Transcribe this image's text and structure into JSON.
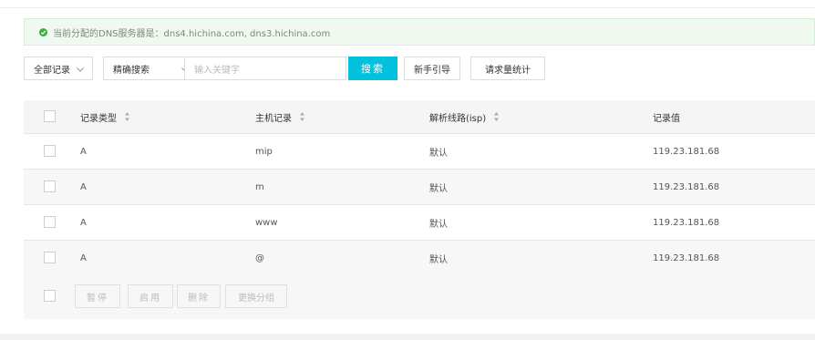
{
  "notice": {
    "text": "当前分配的DNS服务器是：dns4.hichina.com, dns3.hichina.com",
    "icon": "check-circle-icon",
    "color": "#38b03f"
  },
  "toolbar": {
    "record_filter": "全部记录",
    "search_mode": "精确搜索",
    "search_placeholder": "输入关键字",
    "search_button": "搜索",
    "guide_button": "新手引导",
    "stats_button": "请求量统计",
    "primary_color": "#00c1de"
  },
  "table": {
    "columns": [
      "记录类型",
      "主机记录",
      "解析线路(isp)",
      "记录值"
    ],
    "rows": [
      [
        "A",
        "mip",
        "默认",
        "119.23.181.68"
      ],
      [
        "A",
        "m",
        "默认",
        "119.23.181.68"
      ],
      [
        "A",
        "www",
        "默认",
        "119.23.181.68"
      ],
      [
        "A",
        "@",
        "默认",
        "119.23.181.68"
      ]
    ]
  },
  "footer": {
    "pause": "暂停",
    "enable": "启用",
    "delete": "删除",
    "change_group": "更换分组"
  }
}
